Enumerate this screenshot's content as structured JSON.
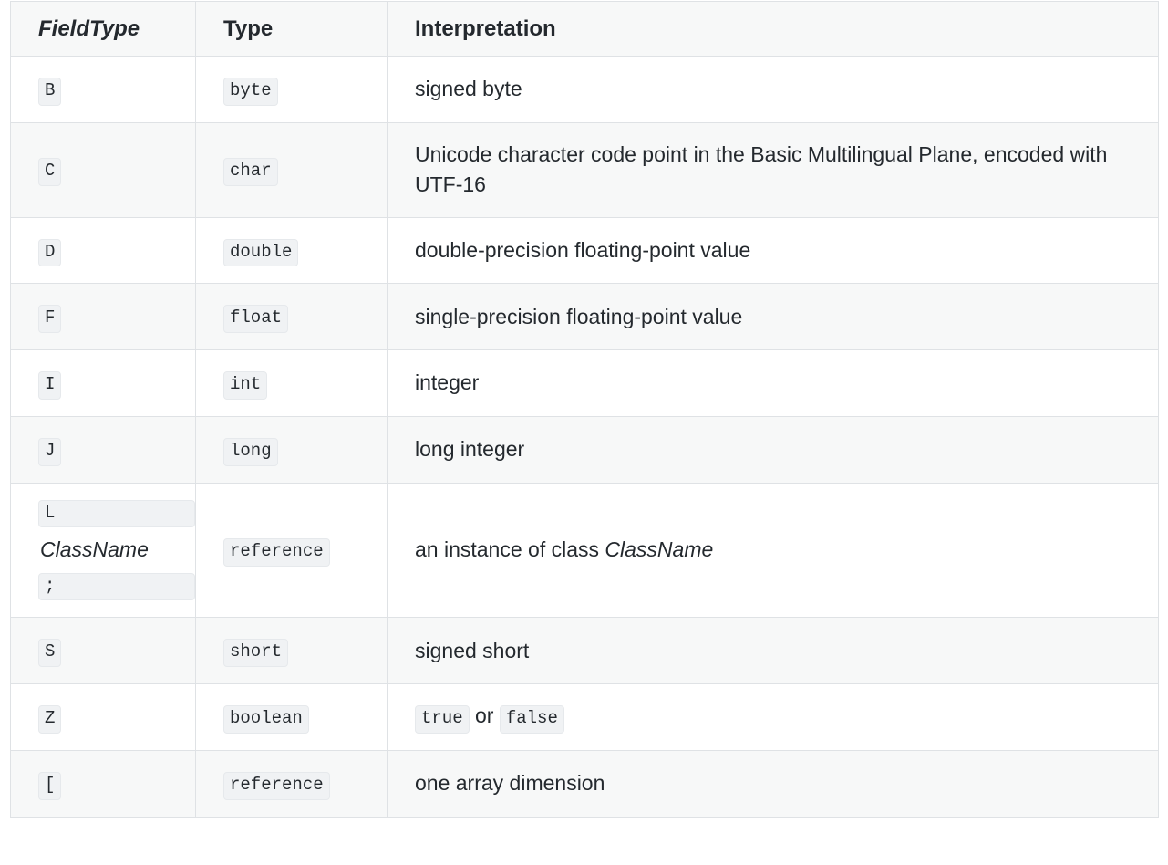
{
  "table": {
    "headers": {
      "fieldtype": "FieldType",
      "type_before_caret": "Interpretatio",
      "type": "Type",
      "interpretation_before_caret": "Interpretatio",
      "interpretation_after_caret": "n"
    },
    "rows": [
      {
        "fieldtype": "B",
        "type": "byte",
        "interpretation": "signed byte"
      },
      {
        "fieldtype": "C",
        "type": "char",
        "interpretation": "Unicode character code point in the Basic Multilingual Plane, encoded with UTF-16"
      },
      {
        "fieldtype": "D",
        "type": "double",
        "interpretation": "double-precision floating-point value"
      },
      {
        "fieldtype": "F",
        "type": "float",
        "interpretation": "single-precision floating-point value"
      },
      {
        "fieldtype": "I",
        "type": "int",
        "interpretation": "integer"
      },
      {
        "fieldtype": "J",
        "type": "long",
        "interpretation": "long integer"
      },
      {
        "fieldtype": "L",
        "fieldtype_classname": "ClassName",
        "fieldtype_terminator": ";",
        "type": "reference",
        "interpretation_prefix": "an instance of class ",
        "interpretation_classname": "ClassName"
      },
      {
        "fieldtype": "S",
        "type": "short",
        "interpretation": "signed short"
      },
      {
        "fieldtype": "Z",
        "type": "boolean",
        "interpretation_true": "true",
        "interpretation_or": " or ",
        "interpretation_false": "false"
      },
      {
        "fieldtype": "[",
        "type": "reference",
        "interpretation": "one array dimension"
      }
    ]
  },
  "colors": {
    "border": "#dfe2e5",
    "row_alt_bg": "#f7f8f8",
    "code_bg": "#f0f2f4",
    "text": "#24292e"
  }
}
